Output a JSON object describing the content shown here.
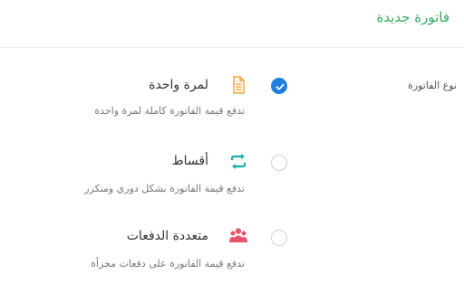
{
  "header": {
    "title": "فاتورة جديدة"
  },
  "field": {
    "label": "نوع الفاتورة"
  },
  "options": [
    {
      "label": "لمرة واحدة",
      "description": "تدفع قيمة الفاتورة كاملة لمرة واحدة",
      "icon": "document-icon",
      "checked": true
    },
    {
      "label": "أقساط",
      "description": "تدفع قيمة الفاتورة بشكل دوري ومتكرر",
      "icon": "repeat-icon",
      "checked": false
    },
    {
      "label": "متعددة الدفعات",
      "description": "تدفع قيمة الفاتورة على دفعات مجزأة",
      "icon": "users-icon",
      "checked": false
    }
  ],
  "colors": {
    "accent": "#3aa85c",
    "radio_checked": "#1f7fe0",
    "doc_icon": "#f0a63a",
    "repeat_icon": "#1ab0a8",
    "users_icon": "#e8556b"
  }
}
